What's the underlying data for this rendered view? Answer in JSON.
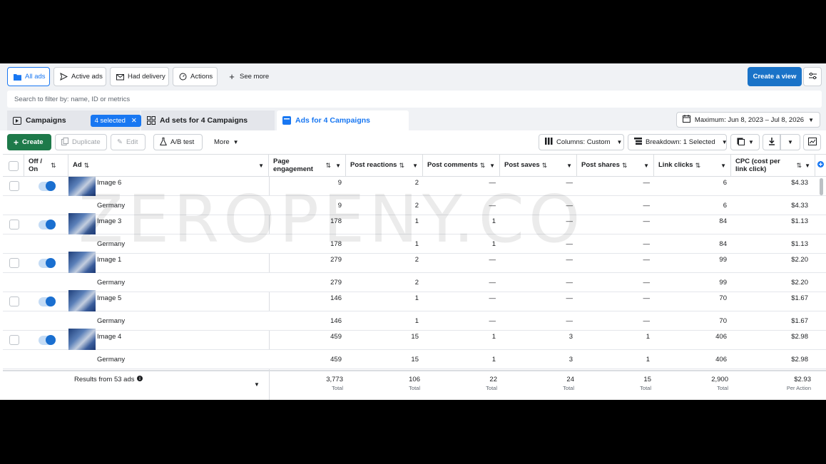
{
  "filter_tabs": [
    {
      "label": "All ads",
      "icon": "folder-icon",
      "active": true
    },
    {
      "label": "Active ads",
      "icon": "send-icon"
    },
    {
      "label": "Had delivery",
      "icon": "envelope-icon"
    },
    {
      "label": "Actions",
      "icon": "actions-icon"
    },
    {
      "label": "See more",
      "icon": "plus-icon"
    }
  ],
  "create_view_label": "Create a view",
  "search": {
    "placeholder": "Search to filter by: name, ID or metrics"
  },
  "level_tabs": {
    "campaigns": "Campaigns",
    "selected_badge": "4 selected",
    "adsets": "Ad sets for 4 Campaigns",
    "ads": "Ads for 4 Campaigns"
  },
  "date_range": "Maximum: Jun 8, 2023 – Jul 8, 2026",
  "toolbar": {
    "create": "Create",
    "duplicate": "Duplicate",
    "edit": "Edit",
    "ab_test": "A/B test",
    "more": "More",
    "columns": "Columns: Custom",
    "breakdown": "Breakdown: 1 Selected"
  },
  "columns": [
    {
      "label": "Off / On"
    },
    {
      "label": "Ad"
    },
    {
      "label": "Page engagement"
    },
    {
      "label": "Post reactions"
    },
    {
      "label": "Post comments"
    },
    {
      "label": "Post saves"
    },
    {
      "label": "Post shares"
    },
    {
      "label": "Link clicks"
    },
    {
      "label": "CPC (cost per link click)"
    }
  ],
  "rows": [
    {
      "type": "ad",
      "name": "Image 6",
      "values": [
        "9",
        "2",
        "—",
        "—",
        "—",
        "6",
        "$4.33"
      ]
    },
    {
      "type": "sub",
      "name": "Germany",
      "values": [
        "9",
        "2",
        "—",
        "—",
        "—",
        "6",
        "$4.33"
      ]
    },
    {
      "type": "ad",
      "name": "Image 3",
      "values": [
        "178",
        "1",
        "1",
        "—",
        "—",
        "84",
        "$1.13"
      ]
    },
    {
      "type": "sub",
      "name": "Germany",
      "values": [
        "178",
        "1",
        "1",
        "—",
        "—",
        "84",
        "$1.13"
      ]
    },
    {
      "type": "ad",
      "name": "Image 1",
      "values": [
        "279",
        "2",
        "—",
        "—",
        "—",
        "99",
        "$2.20"
      ]
    },
    {
      "type": "sub",
      "name": "Germany",
      "values": [
        "279",
        "2",
        "—",
        "—",
        "—",
        "99",
        "$2.20"
      ]
    },
    {
      "type": "ad",
      "name": "Image 5",
      "values": [
        "146",
        "1",
        "—",
        "—",
        "—",
        "70",
        "$1.67"
      ]
    },
    {
      "type": "sub",
      "name": "Germany",
      "values": [
        "146",
        "1",
        "—",
        "—",
        "—",
        "70",
        "$1.67"
      ]
    },
    {
      "type": "ad",
      "name": "Image 4",
      "values": [
        "459",
        "15",
        "1",
        "3",
        "1",
        "406",
        "$2.98"
      ]
    },
    {
      "type": "sub",
      "name": "Germany",
      "values": [
        "459",
        "15",
        "1",
        "3",
        "1",
        "406",
        "$2.98"
      ]
    }
  ],
  "footer": {
    "results": "Results from 53 ads",
    "totals": [
      {
        "value": "3,773",
        "label": "Total"
      },
      {
        "value": "106",
        "label": "Total"
      },
      {
        "value": "22",
        "label": "Total"
      },
      {
        "value": "24",
        "label": "Total"
      },
      {
        "value": "15",
        "label": "Total"
      },
      {
        "value": "2,900",
        "label": "Total"
      },
      {
        "value": "$2.93",
        "label": "Per Action"
      }
    ]
  },
  "watermark": "ZEROPENY.CO",
  "colors": {
    "accent": "#1877f2",
    "primary_button": "#1a73c8",
    "create_button": "#1e7a4a"
  }
}
